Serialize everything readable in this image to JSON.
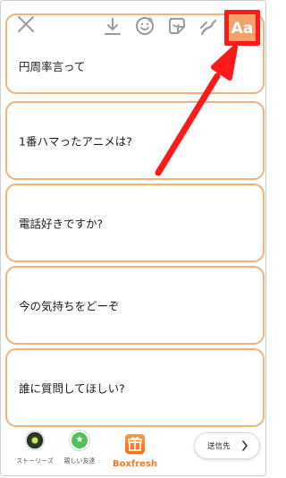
{
  "questions": [
    "円周率言って",
    "1番ハマったアニメは?",
    "電話好きですか?",
    "今の気持ちをどーぞ",
    "誰に質問してほしい?"
  ],
  "toolbar": {
    "close_icon": "close-icon",
    "download_icon": "download-icon",
    "face_icon": "face-sticker-icon",
    "sticker_icon": "sticker-icon",
    "draw_icon": "pen-icon",
    "text_label": "Aa"
  },
  "annotation": {
    "highlight_color": "#ff1a1a",
    "arrow_color": "#ff1a1a"
  },
  "bottom_bar": {
    "story_label": "ストーリーズ",
    "close_friends_label": "親しい友達",
    "brand_label": "Boxfresh",
    "send_label": "送信先"
  },
  "colors": {
    "card_border": "#f4b079",
    "accent": "#f3a36a"
  }
}
